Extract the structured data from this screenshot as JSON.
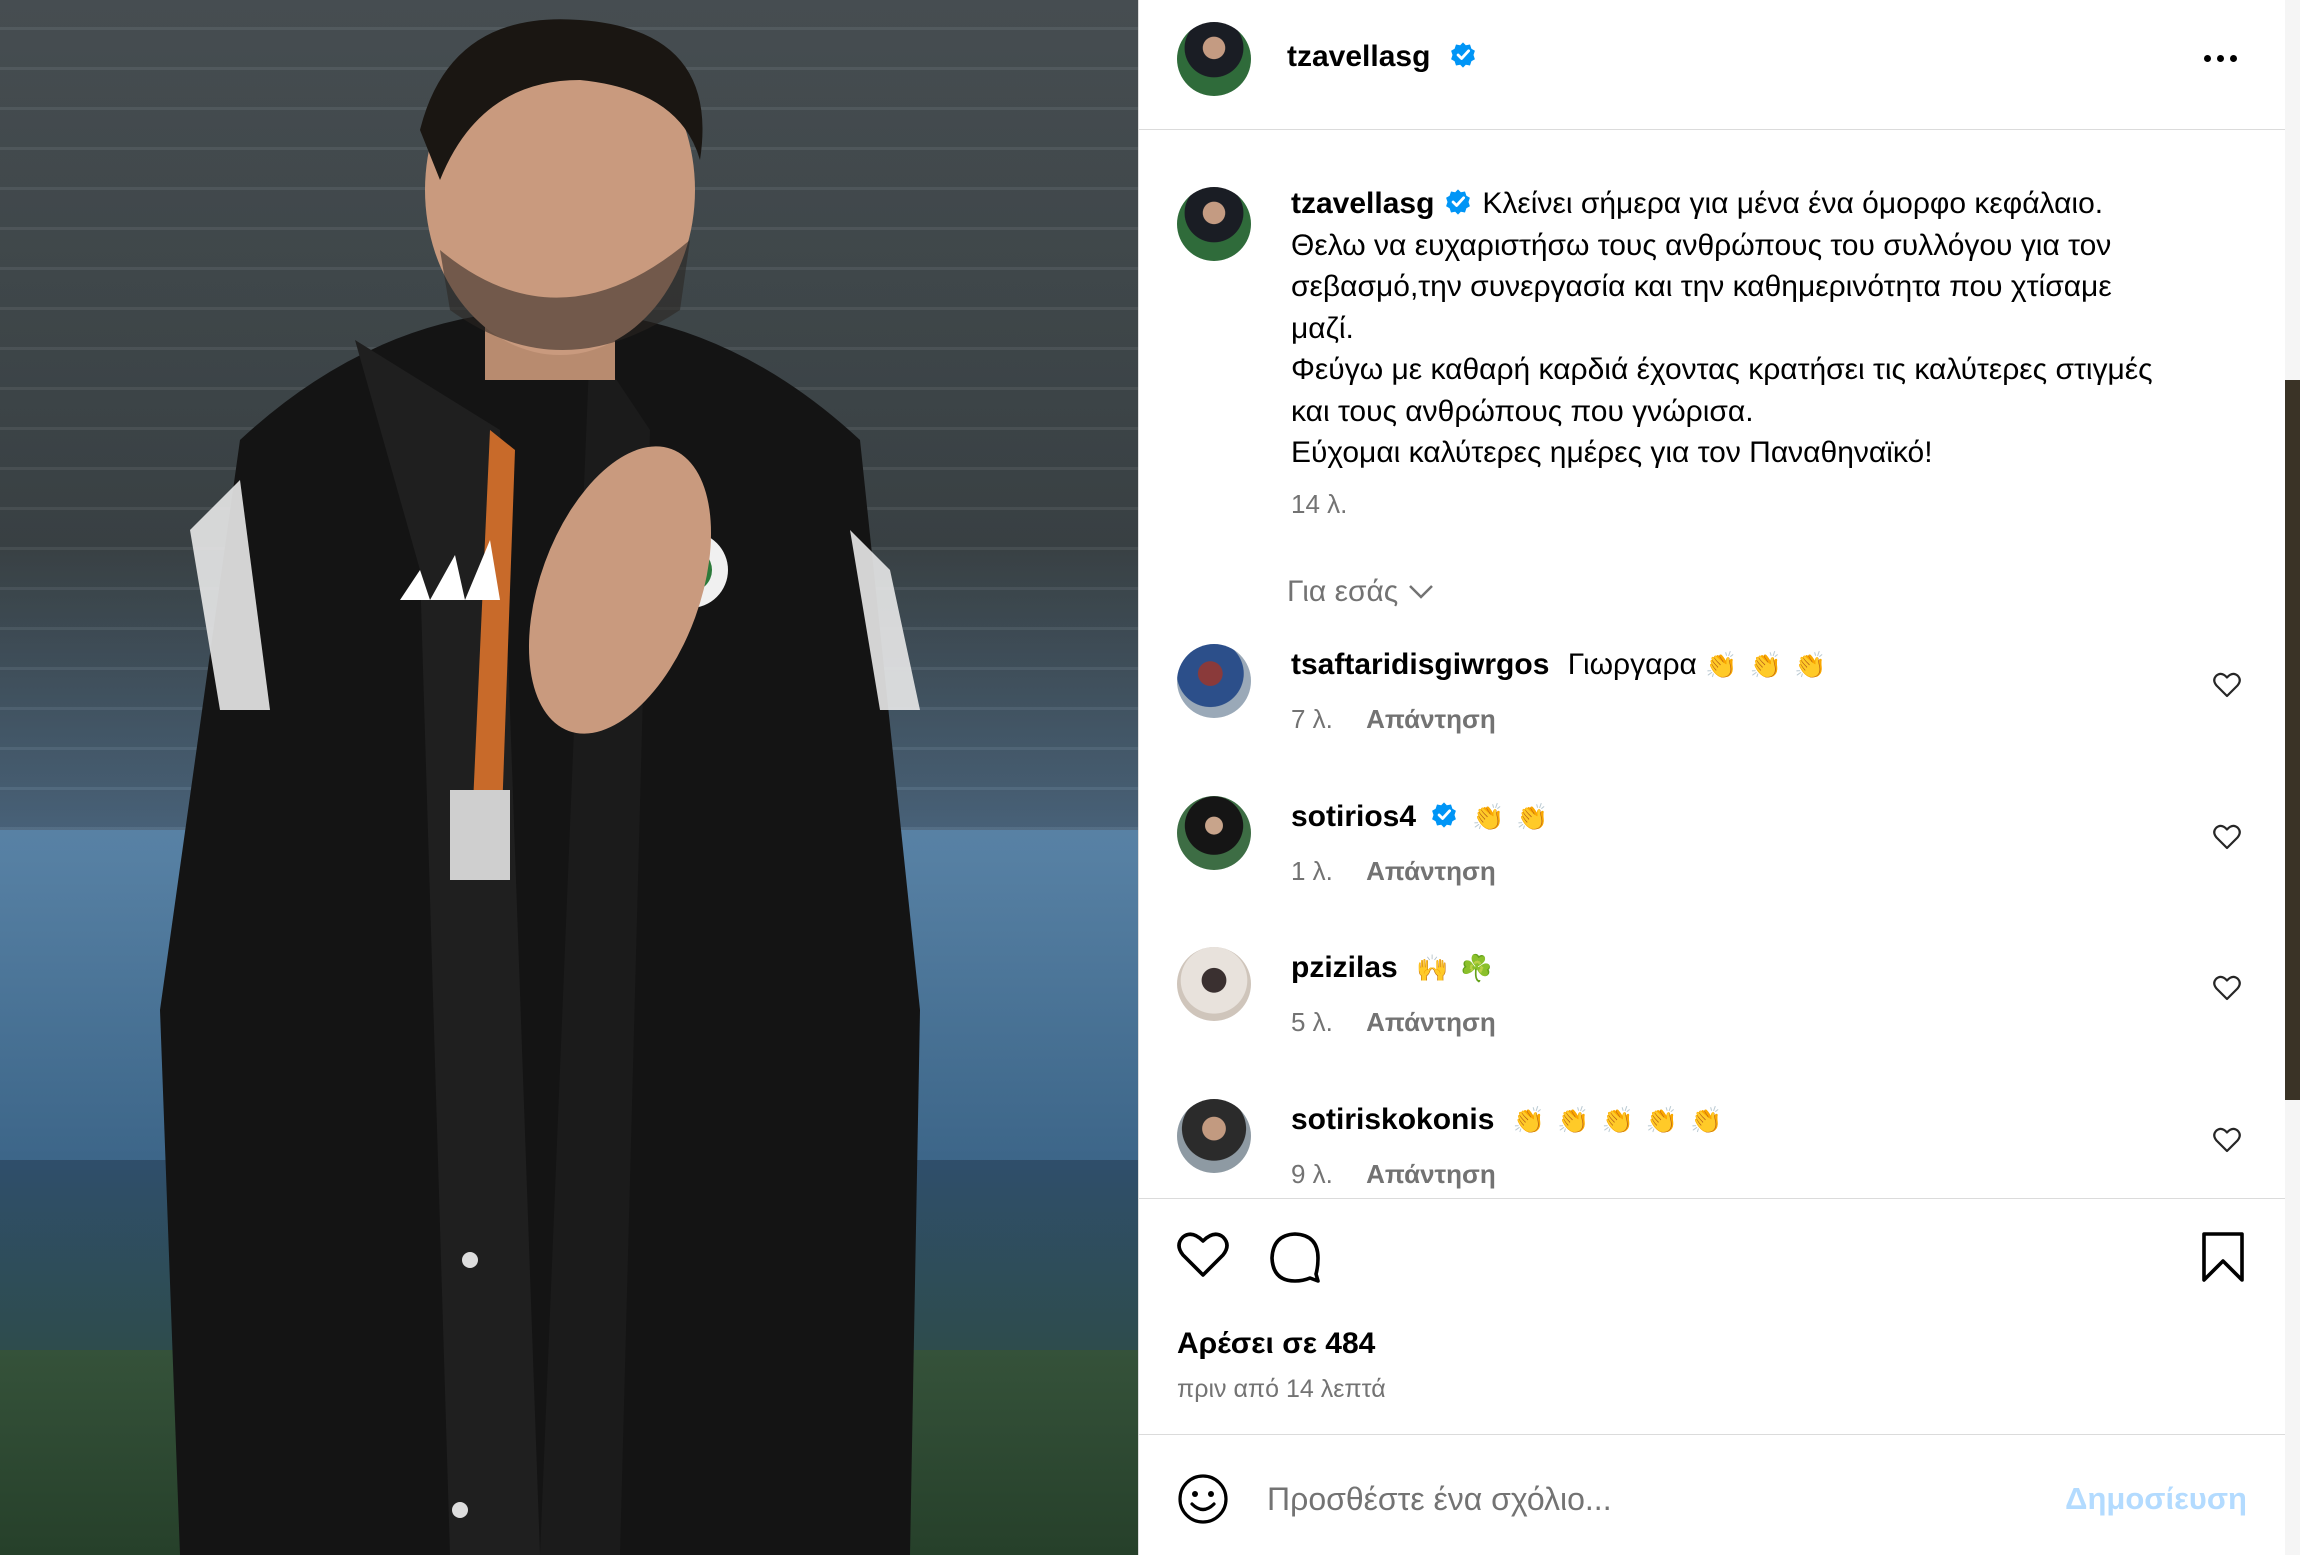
{
  "post": {
    "author": "tzavellasg",
    "verified": true,
    "caption_lines": [
      "Κλείνει σήμερα για μένα ένα όμορφο κεφάλαιο.",
      "Θελω να ευχαριστήσω τους ανθρώπους του συλλόγου για τον",
      "σεβασμό,την συνεργασία και την καθημερινότητα που χτίσαμε",
      "μαζί.",
      "Φεύγω με καθαρή καρδιά έχοντας κρατήσει τις καλύτερες στιγμές",
      "και τους ανθρώπους που γνώρισα.",
      "Εύχομαι καλύτερες ημέρες για τον Παναθηναϊκό!"
    ],
    "caption_time": "14 λ.",
    "for_you_label": "Για εσάς",
    "likes_label": "Αρέσει σε 484",
    "posted_time": "πριν από 14 λεπτά"
  },
  "comments": [
    {
      "user": "tsaftaridisgiwrgos",
      "verified": false,
      "text": "Γιωργαρα",
      "emojis": "👏👏👏",
      "time": "7 λ.",
      "reply_label": "Απάντηση"
    },
    {
      "user": "sotirios4",
      "verified": true,
      "text": "",
      "emojis": "👏👏",
      "time": "1 λ.",
      "reply_label": "Απάντηση"
    },
    {
      "user": "pzizilas",
      "verified": false,
      "text": "",
      "emojis": "🙌☘️",
      "time": "5 λ.",
      "reply_label": "Απάντηση"
    },
    {
      "user": "sotiriskokonis",
      "verified": false,
      "text": "",
      "emojis": "👏👏👏👏👏",
      "time": "9 λ.",
      "reply_label": "Απάντηση"
    }
  ],
  "add_comment": {
    "placeholder": "Προσθέστε ένα σχόλιο...",
    "post_label": "Δημοσίευση"
  },
  "icons": {
    "header_more": "more-horizontal-icon",
    "verified": "verified-badge-icon",
    "like": "heart-icon",
    "comment": "comment-bubble-icon",
    "save": "bookmark-icon",
    "emoji": "smiley-icon"
  },
  "colors": {
    "verified_blue": "#0095f6",
    "muted_text": "#737373",
    "post_button_disabled": "#b3dbff",
    "divider": "#dbdbdb"
  }
}
